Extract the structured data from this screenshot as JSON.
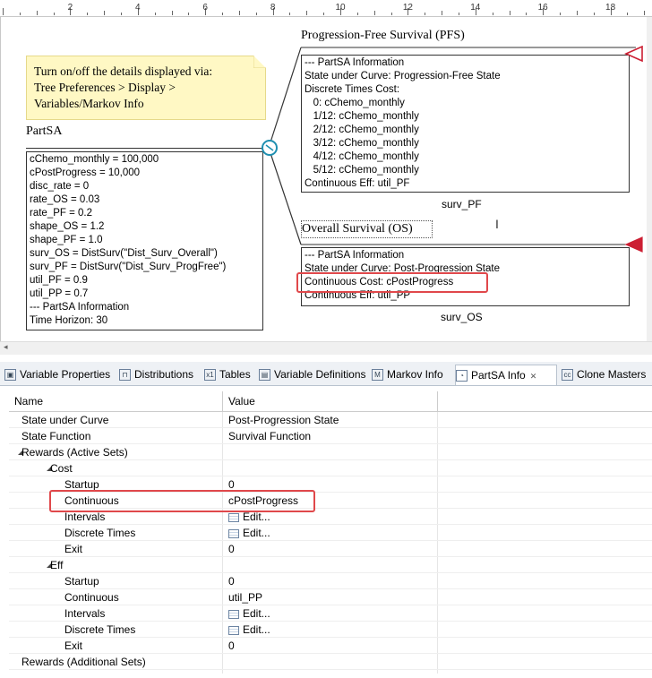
{
  "ruler": {
    "numbers": [
      "2",
      "4",
      "6",
      "8",
      "10",
      "12",
      "14",
      "16",
      "18"
    ]
  },
  "canvas": {
    "note": {
      "line1": "Turn on/off the details displayed via:",
      "line2": "Tree Preferences > Display >",
      "line3": "Variables/Markov Info"
    },
    "root_label": "PartSA",
    "root_vars": [
      "cChemo_monthly = 100,000",
      "cPostProgress = 10,000",
      "disc_rate = 0",
      "rate_OS = 0.03",
      "rate_PF = 0.2",
      "shape_OS = 1.2",
      "shape_PF = 1.0",
      "surv_OS = DistSurv(\"Dist_Surv_Overall\")",
      "surv_PF = DistSurv(\"Dist_Surv_ProgFree\")",
      "util_PF = 0.9",
      "util_PP = 0.7",
      "--- PartSA Information",
      "Time Horizon: 30"
    ],
    "pfs": {
      "title": "Progression-Free Survival (PFS)",
      "lines": [
        "--- PartSA Information",
        "State under Curve: Progression-Free State",
        "Discrete Times Cost:",
        "  0: cChemo_monthly",
        "  1/12: cChemo_monthly",
        "  2/12: cChemo_monthly",
        "  3/12: cChemo_monthly",
        "  4/12: cChemo_monthly",
        "  5/12: cChemo_monthly",
        "Continuous Eff: util_PF"
      ],
      "footer": "surv_PF"
    },
    "os": {
      "title": "Overall Survival (OS)",
      "lines": [
        "--- PartSA Information",
        "State under Curve: Post-Progression State",
        "Continuous Cost: cPostProgress",
        "Continuous Eff: util_PP"
      ],
      "footer": "surv_OS"
    },
    "colors": {
      "terminal_outline": "#cc1f33",
      "terminal_fill": "#cc1f33",
      "highlight": "#e0484b",
      "note_bg": "#fff8c4"
    }
  },
  "tabs": [
    {
      "label": "Variable Properties",
      "icon": "variable-properties-icon",
      "icon_text": "▣"
    },
    {
      "label": "Distributions",
      "icon": "distributions-icon",
      "icon_text": "⊓"
    },
    {
      "label": "Tables",
      "icon": "tables-icon",
      "icon_text": "x1"
    },
    {
      "label": "Variable Definitions",
      "icon": "variable-definitions-icon",
      "icon_text": "▤"
    },
    {
      "label": "Markov Info",
      "icon": "markov-info-icon",
      "icon_text": "M"
    },
    {
      "label": "PartSA Info",
      "icon": "partsa-info-icon",
      "icon_text": "◔",
      "active": true
    },
    {
      "label": "Clone Masters",
      "icon": "clone-masters-icon",
      "icon_text": "cc"
    }
  ],
  "table": {
    "headers": {
      "name": "Name",
      "value": "Value"
    },
    "rows": [
      {
        "name": "State under Curve",
        "value": "Post-Progression State",
        "indent": 0
      },
      {
        "name": "State Function",
        "value": "Survival Function",
        "indent": 0
      },
      {
        "name": "Rewards (Active Sets)",
        "value": "",
        "indent": 0,
        "expander": "◢"
      },
      {
        "name": "Cost",
        "value": "",
        "indent": 1,
        "expander": "◢"
      },
      {
        "name": "Startup",
        "value": "0",
        "indent": 2
      },
      {
        "name": "Continuous",
        "value": "cPostProgress",
        "indent": 2
      },
      {
        "name": "Intervals",
        "value": "Edit...",
        "indent": 2,
        "edit": true
      },
      {
        "name": "Discrete Times",
        "value": "Edit...",
        "indent": 2,
        "edit": true
      },
      {
        "name": "Exit",
        "value": "0",
        "indent": 2
      },
      {
        "name": "Eff",
        "value": "",
        "indent": 1,
        "expander": "◢"
      },
      {
        "name": "Startup",
        "value": "0",
        "indent": 2
      },
      {
        "name": "Continuous",
        "value": "util_PP",
        "indent": 2
      },
      {
        "name": "Intervals",
        "value": "Edit...",
        "indent": 2,
        "edit": true
      },
      {
        "name": "Discrete Times",
        "value": "Edit...",
        "indent": 2,
        "edit": true
      },
      {
        "name": "Exit",
        "value": "0",
        "indent": 2
      },
      {
        "name": "Rewards (Additional Sets)",
        "value": "",
        "indent": 0
      }
    ]
  }
}
